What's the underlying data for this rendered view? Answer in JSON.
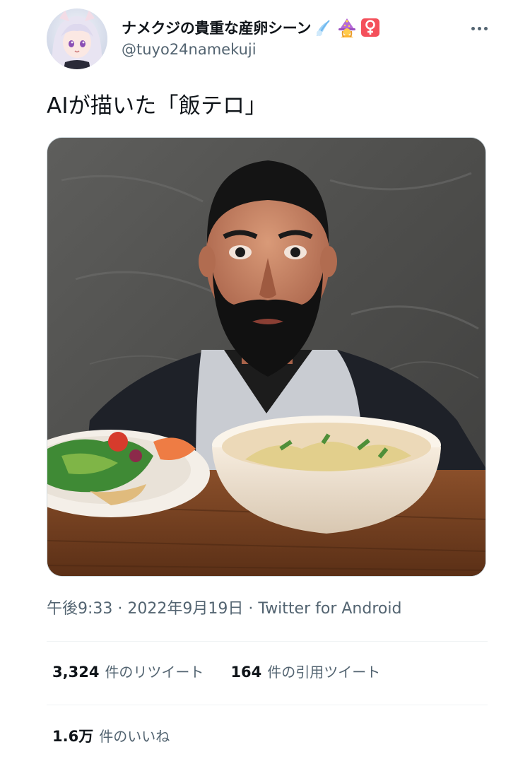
{
  "tweet": {
    "author": {
      "display_name": "ナメクジの貴重な産卵シーン",
      "handle": "@tuyo24namekuji",
      "emojis": [
        "comet-emoji",
        "woman-mage-emoji",
        "female-sign-emoji"
      ]
    },
    "more_icon": "ellipsis-icon",
    "text": "AIが描いた「飯テロ」",
    "time": "午後9:33",
    "separator": "·",
    "date": "2022年9月19日",
    "source": "Twitter for Android"
  },
  "stats": {
    "retweets": {
      "count": "3,324",
      "label": "件のリツイート"
    },
    "quotes": {
      "count": "164",
      "label": "件の引用ツイート"
    },
    "likes": {
      "count": "1.6万",
      "label": "件のいいね"
    }
  },
  "colors": {
    "text_primary": "#0f1419",
    "text_secondary": "#536471",
    "divider": "#eff3f4",
    "emoji_badge": "#f4505b"
  }
}
